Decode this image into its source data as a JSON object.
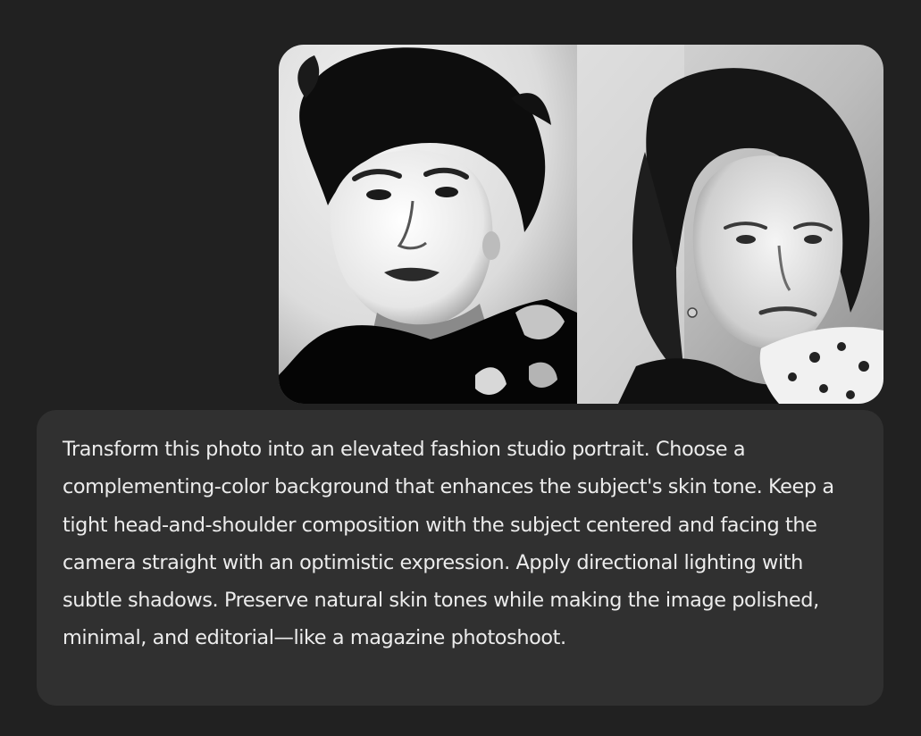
{
  "message": {
    "text": "Transform this photo into an elevated fashion studio portrait. Choose a complementing-color background that enhances the subject's skin tone. Keep a tight head-and-shoulder composition with the subject centered and facing the camera straight with an optimistic expression. Apply directional lighting with subtle shadows. Preserve natural skin tones while making the image polished, minimal, and editorial—like a magazine photoshoot."
  },
  "attachment": {
    "icon": "photo-collage-image",
    "colors": {
      "page_background": "#212121",
      "bubble_background": "#303030",
      "text": "#ececec"
    }
  }
}
